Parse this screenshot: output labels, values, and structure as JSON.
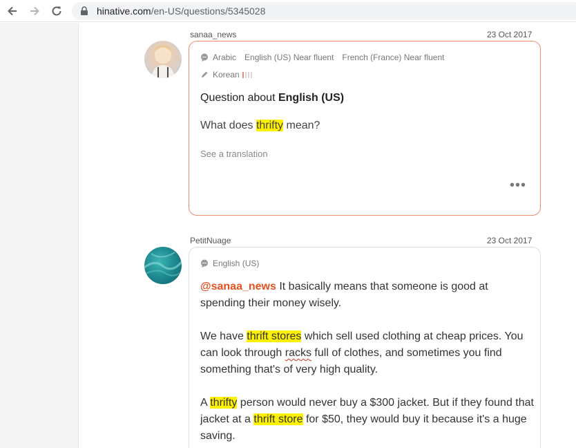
{
  "browser": {
    "url_host": "hinative.com",
    "url_path": "/en-US/questions/5345028"
  },
  "question": {
    "username": "sanaa_news",
    "date": "23 Oct 2017",
    "languages": [
      "Arabic",
      "English (US) Near fluent",
      "French (France) Near fluent"
    ],
    "learning_language": "Korean",
    "learning_level": 1,
    "title_prefix": "Question about ",
    "title_language": "English (US)",
    "body_before": "What does ",
    "body_highlight": "thrifty",
    "body_after": " mean?",
    "see_translation": "See a translation",
    "more": "•••"
  },
  "answer": {
    "username": "PetitNuage",
    "date": "23 Oct 2017",
    "language": "English (US)",
    "p1_mention": "@sanaa_news",
    "p1_text": " It basically means that someone is good at spending their money wisely.",
    "p2_a": "We have ",
    "p2_hl": "thrift stores",
    "p2_b": " which sell used clothing at cheap prices. You can look through ",
    "p2_squiggle": "racks",
    "p2_c": " full of clothes, and sometimes you find something that's of very high quality.",
    "p3_a": "A ",
    "p3_hl1": "thrifty",
    "p3_b": " person would never buy a $300 jacket. But if they found that jacket at a ",
    "p3_hl2": "thrift store",
    "p3_c": " for $50, they would buy it because it's a huge saving."
  },
  "colors": {
    "question_border": "#f08a6d",
    "mention": "#e8501f",
    "highlight": "#fff200"
  }
}
